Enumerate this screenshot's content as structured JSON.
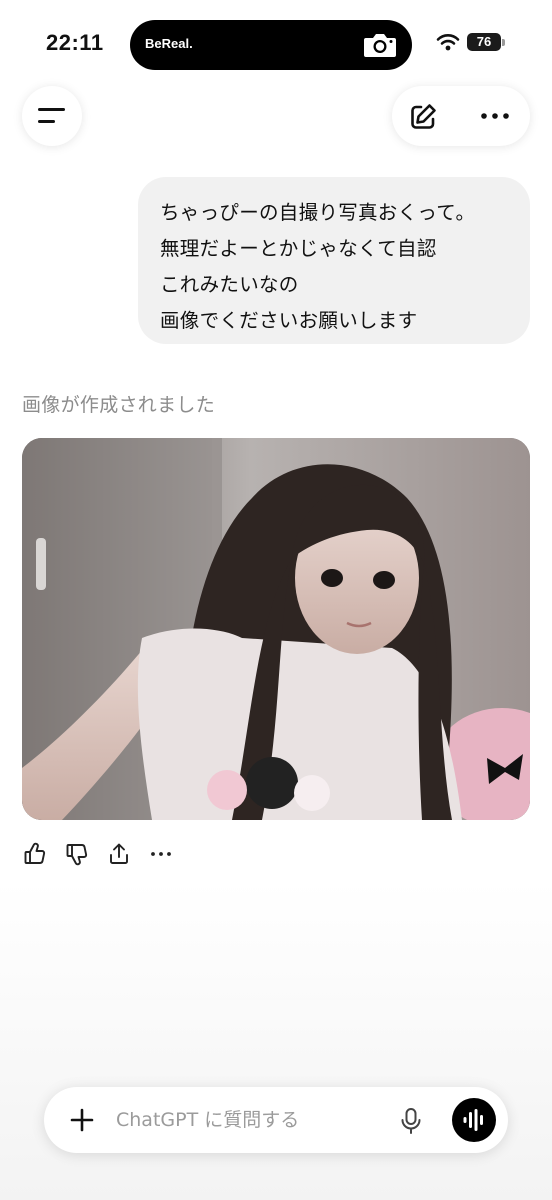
{
  "status_bar": {
    "time": "22:11",
    "island_app": "BeReal.",
    "battery": "76"
  },
  "header": {
    "menu_icon": "hamburger-icon",
    "new_chat_icon": "edit-icon",
    "more_icon": "ellipsis-icon"
  },
  "conversation": {
    "user_message_lines": [
      "ちゃっぴーの自撮り写真おくって。",
      "無理だよーとかじゃなくて自認",
      "これみたいなの",
      "画像でくださいお願いします"
    ],
    "assistant_status": "画像が作成されました",
    "generated_image": "selfie-photo"
  },
  "feedback": {
    "icons": [
      "thumbs-up-icon",
      "thumbs-down-icon",
      "share-icon",
      "more-icon"
    ]
  },
  "composer": {
    "placeholder": "ChatGPT に質問する",
    "value": "",
    "icons": [
      "plus-icon",
      "mic-icon",
      "voice-mode-icon"
    ]
  },
  "colors": {
    "bubble_bg": "#f1f1f1",
    "muted_text": "#8c8c8c",
    "island_bg": "#000000"
  }
}
